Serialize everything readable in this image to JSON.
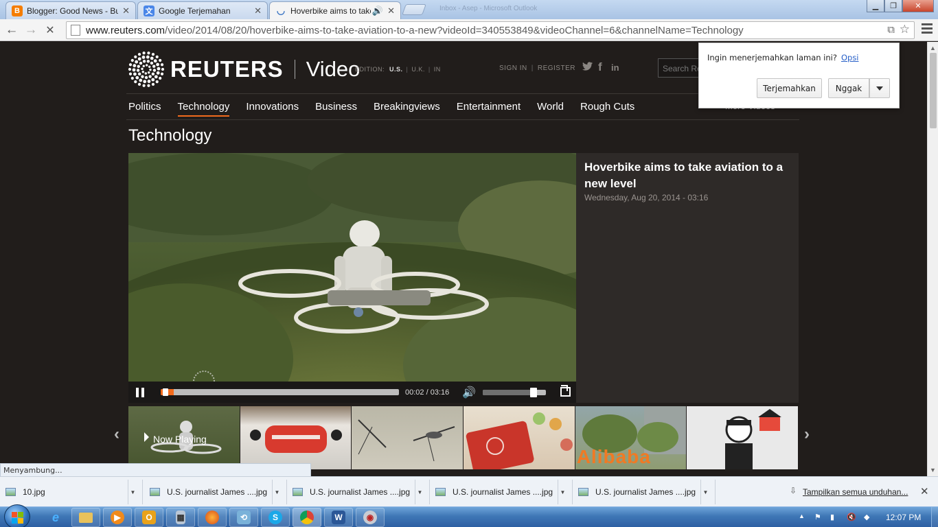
{
  "browser": {
    "tabs": [
      {
        "title": "Blogger: Good News - Buat",
        "icon": "blogger-icon",
        "color": "#f57d00"
      },
      {
        "title": "Google Terjemahan",
        "icon": "google-translate-icon",
        "color": "#4a86e8"
      },
      {
        "title": "Hoverbike aims to take aviation",
        "icon": "loading-spinner-icon",
        "color": "#3d76c4"
      }
    ],
    "ghost_tab_text": "Inbox - Asep - Microsoft Outlook",
    "url_host": "www.reuters.com",
    "url_path": "/video/2014/08/20/hoverbike-aims-to-take-aviation-to-a-new?videoId=340553849&videoChannel=6&channelName=Technology",
    "status_text": "Menyambung..."
  },
  "site": {
    "logo_word": "REUTERS",
    "logo_section": "Video",
    "edition_label": "EDITION:",
    "editions": [
      "U.S.",
      "U.K.",
      "IN"
    ],
    "sign_in": "SIGN IN",
    "register": "REGISTER",
    "search_placeholder": "Search Reuters",
    "nav": [
      "Politics",
      "Technology",
      "Innovations",
      "Business",
      "Breakingviews",
      "Entertainment",
      "World",
      "Rough Cuts"
    ],
    "active_nav": "Technology",
    "more_videos": "More Videos",
    "section_title": "Technology",
    "accent_color": "#f26b1d"
  },
  "video": {
    "title": "Hoverbike aims to take aviation to a new level",
    "date": "Wednesday, Aug 20, 2014 - 03:16",
    "time_current": "00:02",
    "time_total": "03:16",
    "progress_fraction": 0.01,
    "volume_fraction": 0.8
  },
  "thumbnails": {
    "now_playing_label": "Now Playing",
    "overlay_text": "Alibaba"
  },
  "translate_bar": {
    "question": "Ingin menerjemahkan laman ini?",
    "options_link": "Opsi",
    "translate_button": "Terjemahkan",
    "no_button": "Nggak"
  },
  "downloads": {
    "items": [
      "10.jpg",
      "U.S. journalist James ....jpg",
      "U.S. journalist James ....jpg",
      "U.S. journalist James ....jpg",
      "U.S. journalist James ....jpg"
    ],
    "show_all": "Tampilkan semua unduhan..."
  },
  "taskbar": {
    "apps": [
      "internet-explorer-icon",
      "file-explorer-icon",
      "media-player-icon",
      "outlook-icon",
      "calculator-icon",
      "firefox-icon",
      "network-icon",
      "skype-icon",
      "chrome-icon",
      "word-icon",
      "app-icon"
    ],
    "clock": "12:07 PM"
  }
}
